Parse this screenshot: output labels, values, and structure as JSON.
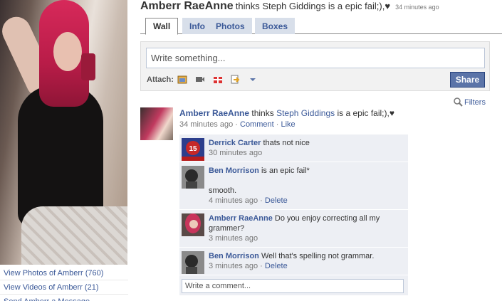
{
  "profile": {
    "name": "Amberr RaeAnne",
    "status": "thinks Steph Giddings is a epic fail;),♥",
    "status_time": "34 minutes ago"
  },
  "left_links": [
    "View Photos of Amberr (760)",
    "View Videos of Amberr (21)",
    "Send Amberr a Message"
  ],
  "tabs": [
    {
      "label": "Wall",
      "active": true
    },
    {
      "label": "Info",
      "active": false
    },
    {
      "label": "Photos",
      "active": false
    },
    {
      "label": "Boxes",
      "active": false
    }
  ],
  "composer": {
    "placeholder": "Write something...",
    "attach_label": "Attach:",
    "attach_icons": [
      "photo-icon",
      "video-icon",
      "gift-icon",
      "link-icon"
    ],
    "share_label": "Share"
  },
  "filters_label": "Filters",
  "story": {
    "actor": "Amberr RaeAnne",
    "text_before": "thinks",
    "mention": "Steph Giddings",
    "text_after": "is a epic fail;),♥",
    "time": "34 minutes ago",
    "comment_link": "Comment",
    "like_link": "Like"
  },
  "comments": [
    {
      "author": "Derrick Carter",
      "text": "thats not nice",
      "time": "30 minutes ago",
      "delete": ""
    },
    {
      "author": "Ben Morrison",
      "text": "is an epic fail*",
      "text2": "smooth.",
      "time": "4 minutes ago",
      "delete": "Delete"
    },
    {
      "author": "Amberr RaeAnne",
      "text": "Do you enjoy correcting all my grammer?",
      "time": "3 minutes ago",
      "delete": ""
    },
    {
      "author": "Ben Morrison",
      "text": "Well that's spelling not grammar.",
      "time": "3 minutes ago",
      "delete": "Delete"
    }
  ],
  "comment_input_placeholder": "Write a comment...",
  "colors": {
    "brand": "#3b5998",
    "tab_bg": "#d8dfea",
    "comment_bg": "#edeff4",
    "share_btn": "#5b74a8"
  }
}
